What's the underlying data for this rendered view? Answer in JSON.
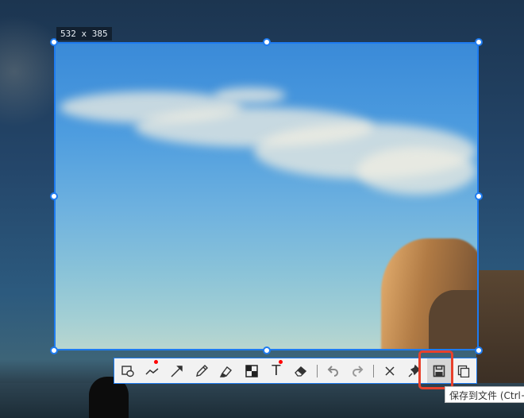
{
  "selection": {
    "size_label": "532 x 385",
    "width": 532,
    "height": 385
  },
  "toolbar": {
    "tools": [
      {
        "name": "rectangle-ellipse",
        "has_dot": false
      },
      {
        "name": "polyline",
        "has_dot": true
      },
      {
        "name": "arrow",
        "has_dot": false
      },
      {
        "name": "pencil",
        "has_dot": false
      },
      {
        "name": "marker",
        "has_dot": false
      },
      {
        "name": "mosaic",
        "has_dot": false
      },
      {
        "name": "text",
        "has_dot": true,
        "glyph": "T"
      },
      {
        "name": "eraser",
        "has_dot": false
      }
    ],
    "actions": [
      "undo",
      "redo",
      "close",
      "pin",
      "save",
      "copy"
    ],
    "active": "save",
    "accent_color": "#1e7bf0",
    "highlight_color": "#e8412c"
  },
  "tooltip": {
    "text": "保存到文件 (Ctrl+"
  }
}
